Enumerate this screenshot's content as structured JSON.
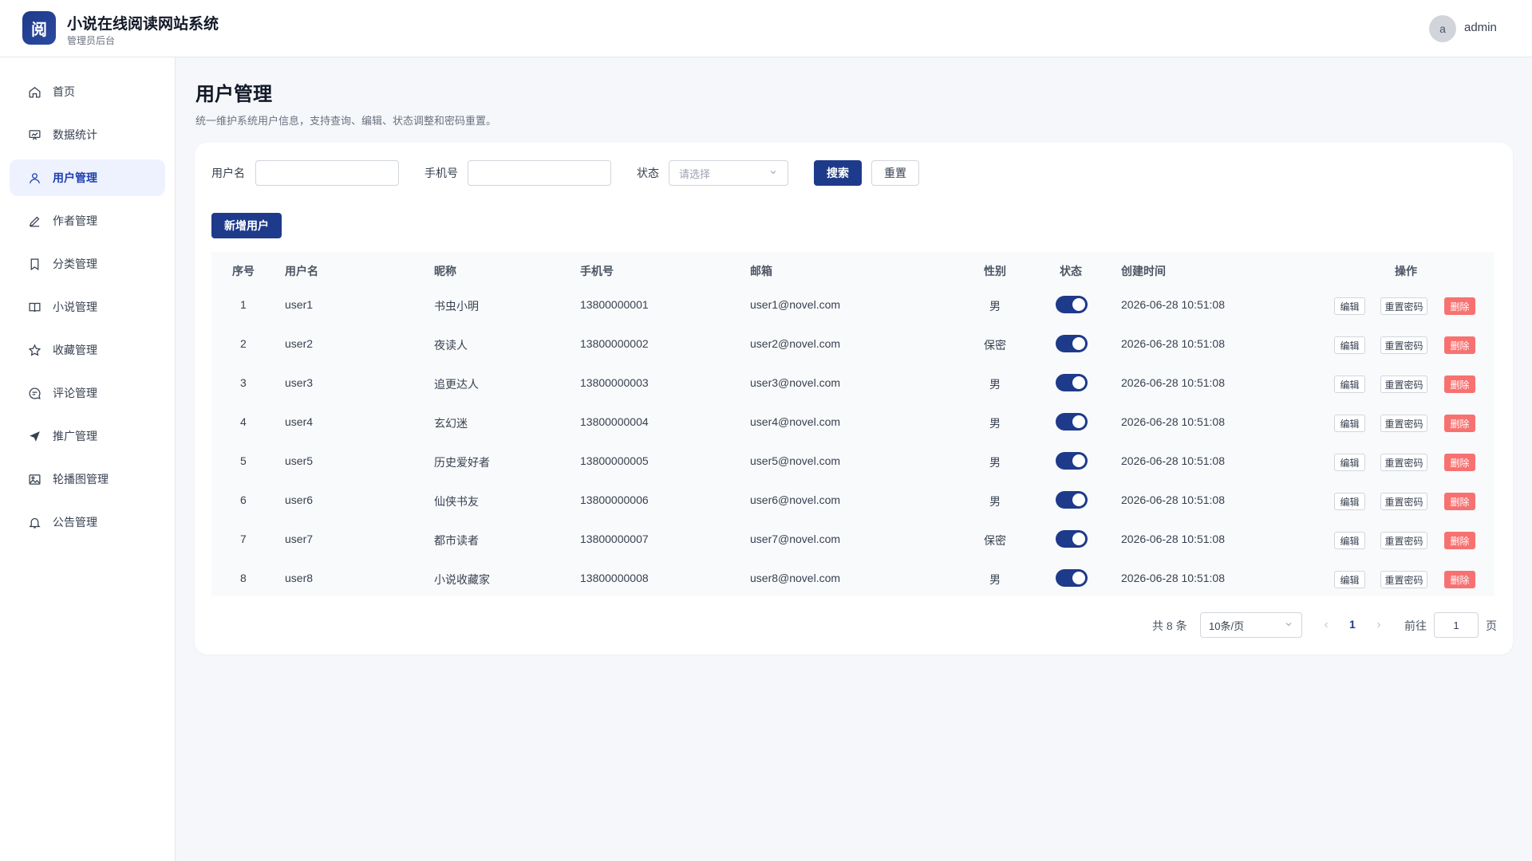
{
  "app": {
    "logo_char": "阅",
    "title": "小说在线阅读网站系统",
    "subtitle": "管理员后台"
  },
  "user": {
    "avatar_letter": "a",
    "name": "admin"
  },
  "sidebar": {
    "items": [
      {
        "label": "首页",
        "icon": "home-icon"
      },
      {
        "label": "数据统计",
        "icon": "chart-icon"
      },
      {
        "label": "用户管理",
        "icon": "user-icon",
        "active": true
      },
      {
        "label": "作者管理",
        "icon": "pen-icon"
      },
      {
        "label": "分类管理",
        "icon": "bookmark-icon"
      },
      {
        "label": "小说管理",
        "icon": "book-icon"
      },
      {
        "label": "收藏管理",
        "icon": "star-icon"
      },
      {
        "label": "评论管理",
        "icon": "comment-icon"
      },
      {
        "label": "推广管理",
        "icon": "send-icon"
      },
      {
        "label": "轮播图管理",
        "icon": "image-icon"
      },
      {
        "label": "公告管理",
        "icon": "bell-icon"
      }
    ]
  },
  "page": {
    "title": "用户管理",
    "description": "统一维护系统用户信息，支持查询、编辑、状态调整和密码重置。"
  },
  "filters": {
    "username_label": "用户名",
    "username_value": "",
    "phone_label": "手机号",
    "phone_value": "",
    "status_label": "状态",
    "status_placeholder": "请选择",
    "search_label": "搜索",
    "reset_label": "重置"
  },
  "add_button": "新增用户",
  "table": {
    "headers": {
      "index": "序号",
      "username": "用户名",
      "nickname": "昵称",
      "phone": "手机号",
      "email": "邮箱",
      "gender": "性别",
      "status": "状态",
      "created": "创建时间",
      "actions": "操作"
    },
    "action_labels": {
      "edit": "编辑",
      "reset_pwd": "重置密码",
      "delete": "删除"
    },
    "rows": [
      {
        "index": "1",
        "username": "user1",
        "nickname": "书虫小明",
        "phone": "13800000001",
        "email": "user1@novel.com",
        "gender": "男",
        "enabled": true,
        "created": "2026-06-28 10:51:08"
      },
      {
        "index": "2",
        "username": "user2",
        "nickname": "夜读人",
        "phone": "13800000002",
        "email": "user2@novel.com",
        "gender": "保密",
        "enabled": true,
        "created": "2026-06-28 10:51:08"
      },
      {
        "index": "3",
        "username": "user3",
        "nickname": "追更达人",
        "phone": "13800000003",
        "email": "user3@novel.com",
        "gender": "男",
        "enabled": true,
        "created": "2026-06-28 10:51:08"
      },
      {
        "index": "4",
        "username": "user4",
        "nickname": "玄幻迷",
        "phone": "13800000004",
        "email": "user4@novel.com",
        "gender": "男",
        "enabled": true,
        "created": "2026-06-28 10:51:08"
      },
      {
        "index": "5",
        "username": "user5",
        "nickname": "历史爱好者",
        "phone": "13800000005",
        "email": "user5@novel.com",
        "gender": "男",
        "enabled": true,
        "created": "2026-06-28 10:51:08"
      },
      {
        "index": "6",
        "username": "user6",
        "nickname": "仙侠书友",
        "phone": "13800000006",
        "email": "user6@novel.com",
        "gender": "男",
        "enabled": true,
        "created": "2026-06-28 10:51:08"
      },
      {
        "index": "7",
        "username": "user7",
        "nickname": "都市读者",
        "phone": "13800000007",
        "email": "user7@novel.com",
        "gender": "保密",
        "enabled": true,
        "created": "2026-06-28 10:51:08"
      },
      {
        "index": "8",
        "username": "user8",
        "nickname": "小说收藏家",
        "phone": "13800000008",
        "email": "user8@novel.com",
        "gender": "男",
        "enabled": true,
        "created": "2026-06-28 10:51:08"
      }
    ]
  },
  "pagination": {
    "total_text": "共 8 条",
    "page_size": "10条/页",
    "current_page": "1",
    "goto_label": "前往",
    "goto_value": "1",
    "page_suffix": "页"
  },
  "colors": {
    "primary": "#1e3a8a",
    "danger": "#f87171",
    "active_bg": "#eef2ff"
  }
}
